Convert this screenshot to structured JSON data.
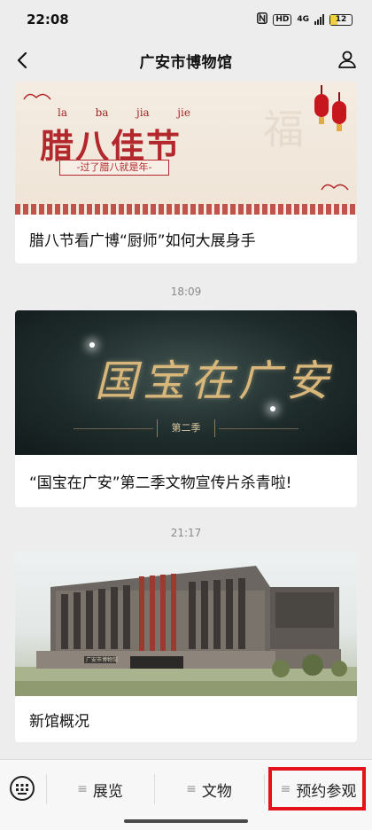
{
  "status_bar": {
    "time": "22:08",
    "icons": [
      "nfc-icon",
      "hd-icon",
      "signal-icon",
      "battery-icon"
    ],
    "hd_label": "HD",
    "network_label": "4G",
    "battery_level": "12"
  },
  "nav": {
    "title": "广安市博物馆",
    "back_icon": "chevron-left-icon",
    "profile_icon": "user-icon"
  },
  "articles": [
    {
      "caption": "腊八节看广博“厨师”如何大展身手",
      "banner": {
        "pinyin": [
          "la",
          "ba",
          "jia",
          "jie"
        ],
        "title": "腊八佳节",
        "subtitle": "-过了腊八就是年-",
        "watermark": "福"
      }
    },
    {
      "timestamp": "18:09",
      "caption": "“国宝在广安”第二季文物宣传片杀青啦!",
      "banner": {
        "title": "国宝在广安",
        "season": "第二季"
      }
    },
    {
      "timestamp": "21:17",
      "caption": "新馆概况",
      "banner": {
        "sign": "广安市博物馆"
      }
    }
  ],
  "menu": {
    "keyboard_icon": "keyboard-icon",
    "items": [
      {
        "label": "展览",
        "icon": "menu-lines-icon"
      },
      {
        "label": "文物",
        "icon": "menu-lines-icon"
      },
      {
        "label": "预约参观",
        "icon": "menu-lines-icon"
      }
    ],
    "highlight_color": "#e3121c"
  },
  "colors": {
    "background": "#ededed",
    "card": "#ffffff",
    "festival_red": "#b3282d",
    "gold": "#d9b77a"
  }
}
